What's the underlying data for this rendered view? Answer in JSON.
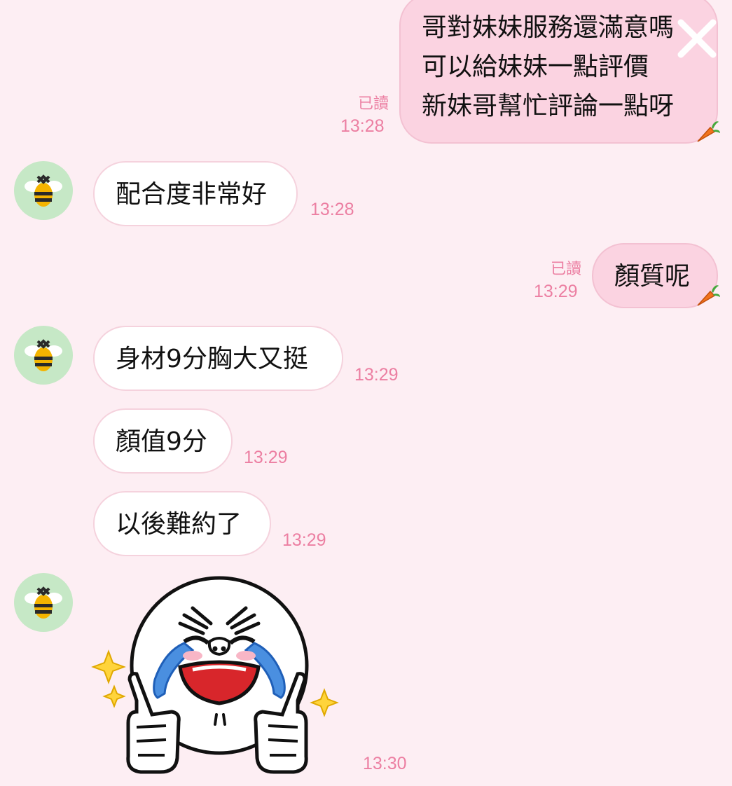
{
  "messages": [
    {
      "id": "m1",
      "direction": "outgoing",
      "lines": [
        "哥對妹妹服務還滿意嗎",
        "可以給妹妹一點評價",
        "新妹哥幫忙評論一點呀"
      ],
      "read": "已讀",
      "time": "13:28"
    },
    {
      "id": "m2",
      "direction": "incoming",
      "lines": [
        "配合度非常好"
      ],
      "time": "13:28"
    },
    {
      "id": "m3",
      "direction": "outgoing",
      "lines": [
        "顏質呢"
      ],
      "read": "已讀",
      "time": "13:29"
    },
    {
      "id": "m4",
      "direction": "incoming",
      "lines": [
        "身材9分胸大又挺"
      ],
      "time": "13:29"
    },
    {
      "id": "m5",
      "direction": "incoming",
      "lines": [
        "顏值9分"
      ],
      "time": "13:29"
    },
    {
      "id": "m6",
      "direction": "incoming",
      "lines": [
        "以後難約了"
      ],
      "time": "13:29"
    },
    {
      "id": "m7",
      "direction": "incoming",
      "type": "sticker",
      "sticker": "thumbs-up-crying-moon-sticker",
      "time": "13:30"
    }
  ],
  "avatar_icon": "bee-icon",
  "reaction_icon": "carrot-icon",
  "colors": {
    "background": "#fdeef3",
    "outgoing_bubble": "#fbd3e1",
    "incoming_bubble": "#ffffff",
    "timestamp": "#ec7fa2",
    "avatar_bg": "#c6e8c6"
  }
}
